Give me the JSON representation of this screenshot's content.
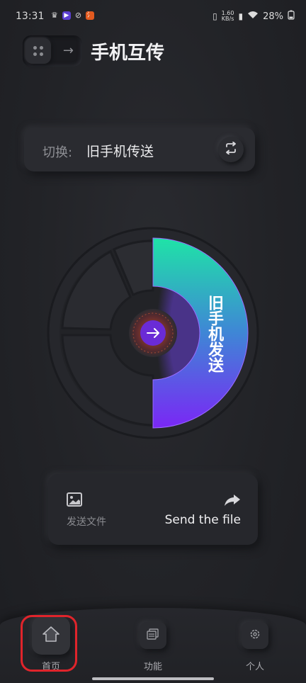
{
  "status_bar": {
    "time": "13:31",
    "network_speed_value": "1.60",
    "network_speed_unit": "KB/s",
    "battery": "28%"
  },
  "header": {
    "title": "手机互传"
  },
  "switch_card": {
    "label": "切换:",
    "value": "旧手机传送"
  },
  "dial": {
    "label": "旧手机发送",
    "accent_gradient": [
      "#1fe3a7",
      "#7a27f5"
    ]
  },
  "send_card": {
    "left_label": "发送文件",
    "right_label": "Send the file"
  },
  "bottom_nav": {
    "items": [
      {
        "label": "首页",
        "icon": "home-icon",
        "active": true
      },
      {
        "label": "功能",
        "icon": "files-icon",
        "active": false
      },
      {
        "label": "个人",
        "icon": "settings-icon",
        "active": false
      }
    ]
  },
  "colors": {
    "background": "#202125",
    "highlight": "#e0242b"
  }
}
